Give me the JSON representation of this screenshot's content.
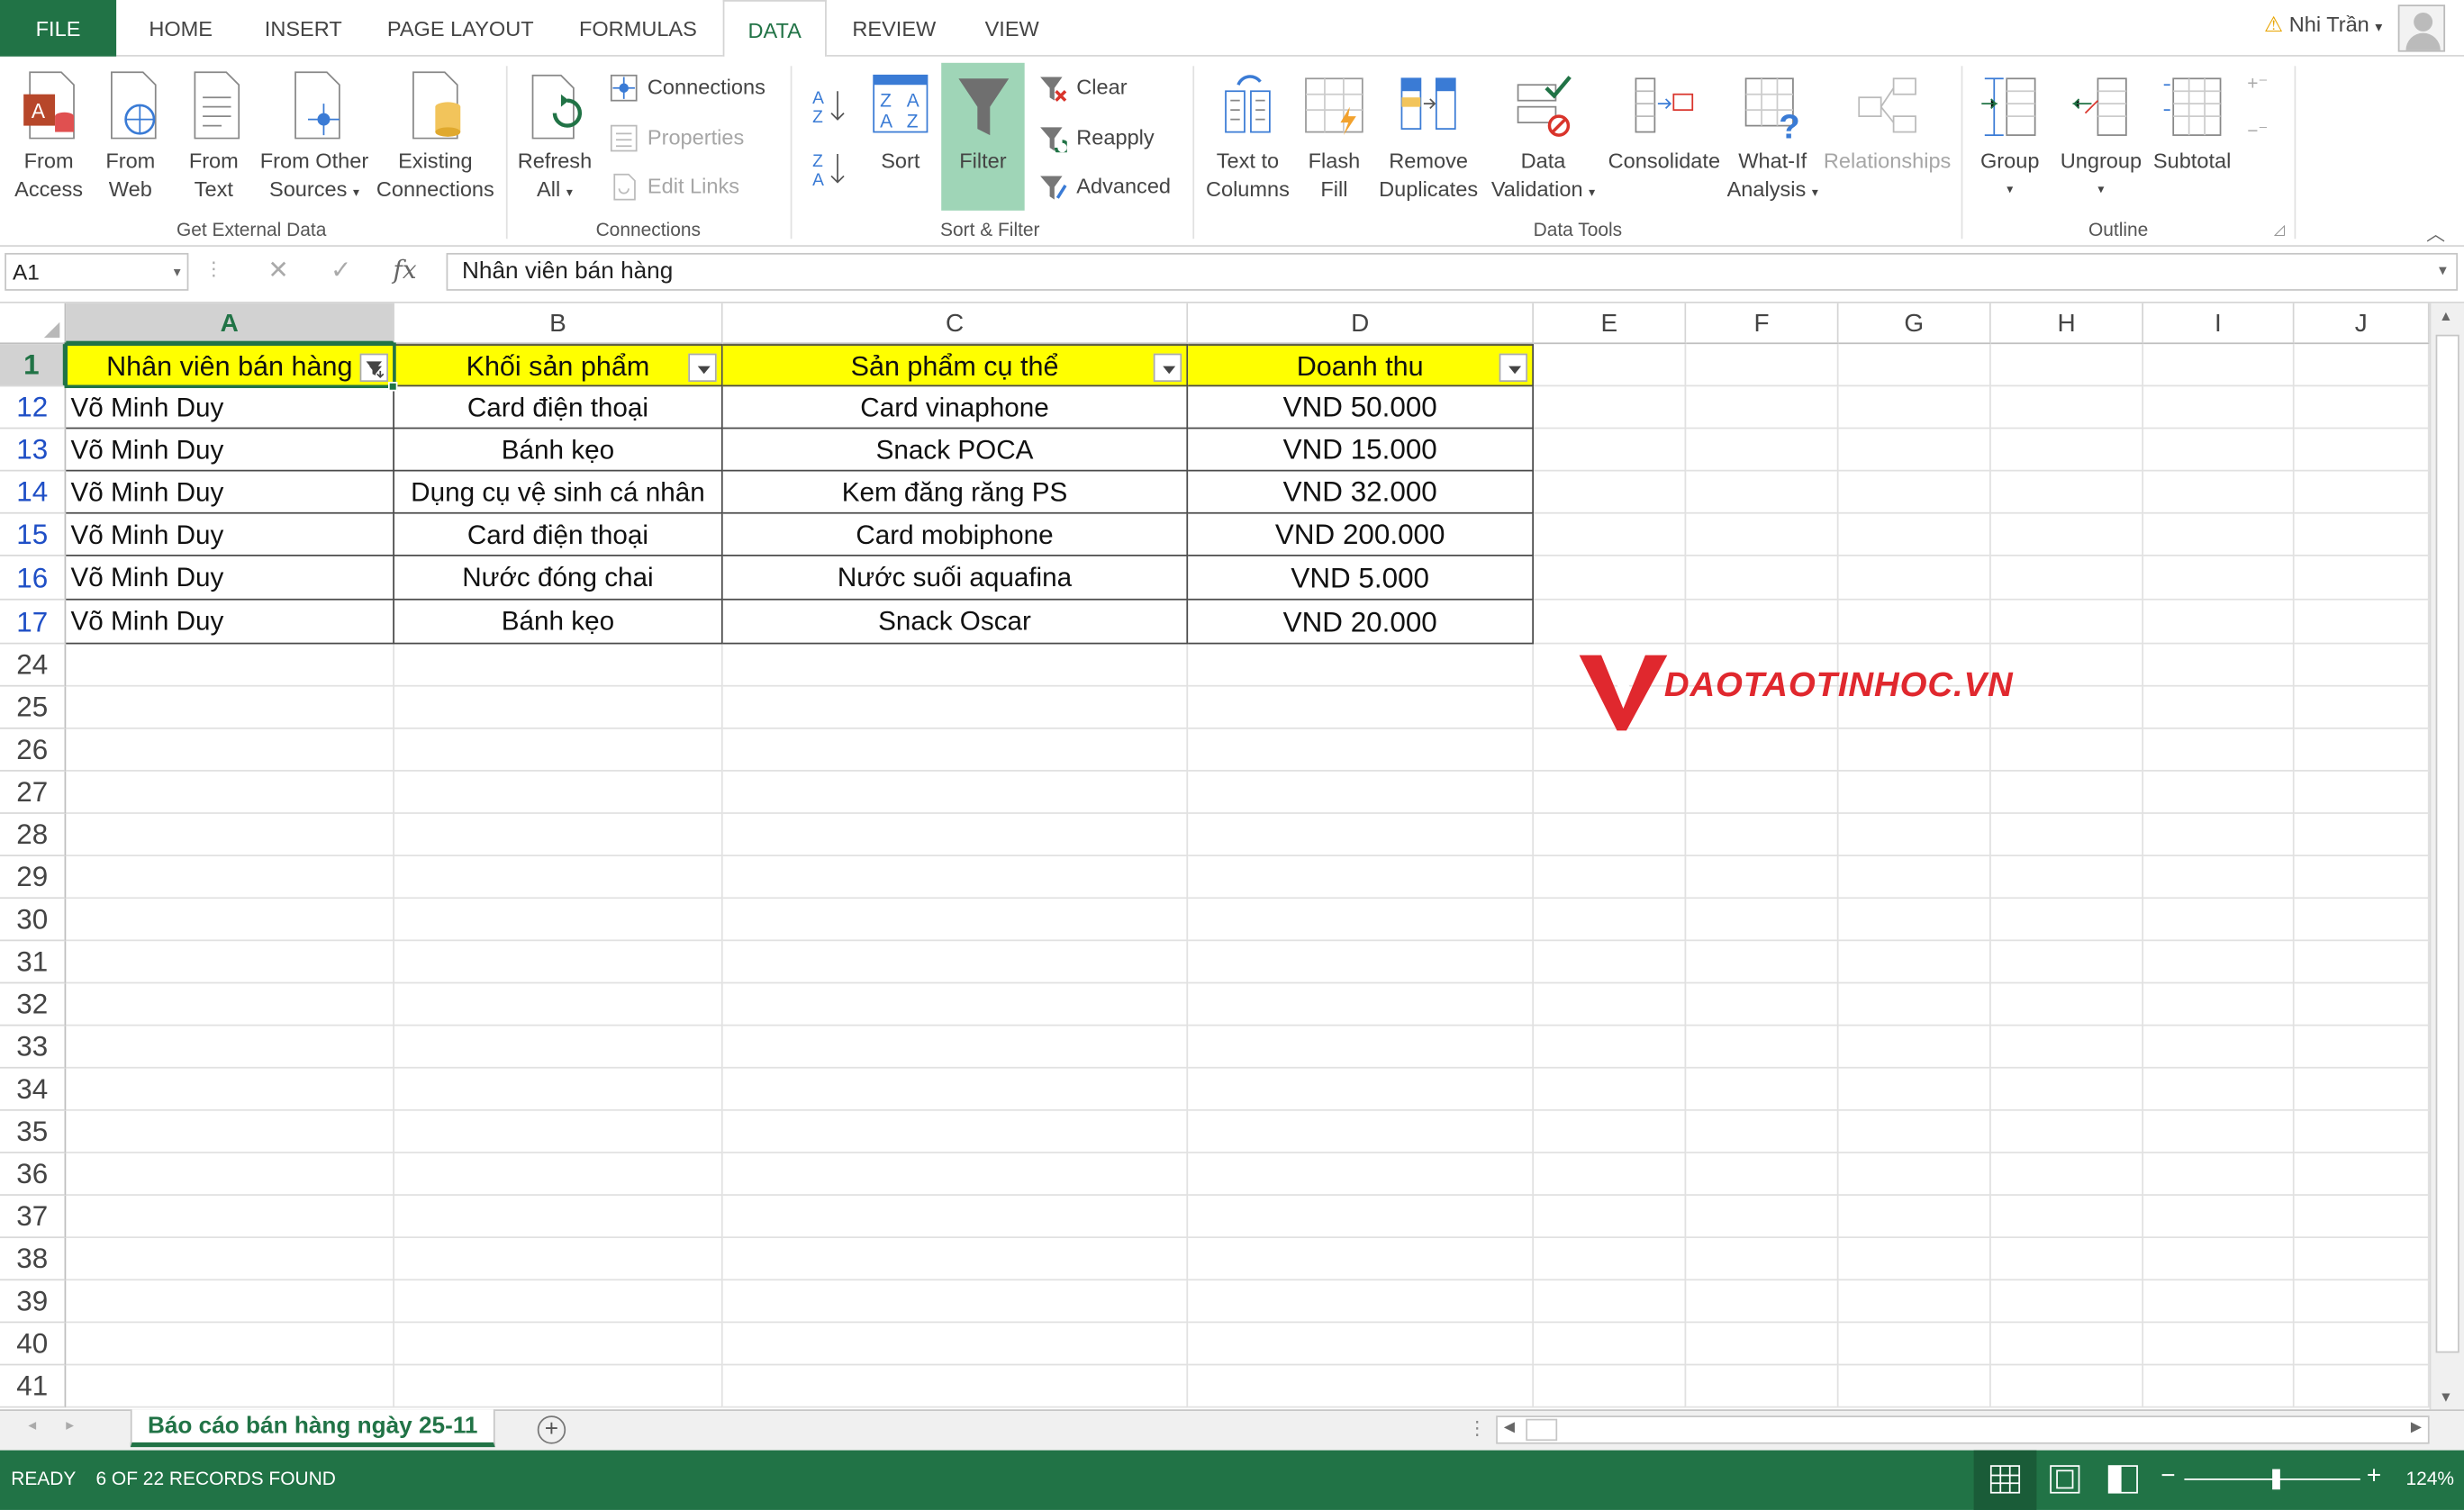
{
  "tabs": [
    "FILE",
    "HOME",
    "INSERT",
    "PAGE LAYOUT",
    "FORMULAS",
    "DATA",
    "REVIEW",
    "VIEW"
  ],
  "active_tab": "DATA",
  "user_name": "Nhi Trần",
  "ribbon": {
    "get_external_data": {
      "label": "Get External Data",
      "buttons": [
        [
          "From",
          "Access"
        ],
        [
          "From",
          "Web"
        ],
        [
          "From",
          "Text"
        ],
        [
          "From Other",
          "Sources"
        ],
        [
          "Existing",
          "Connections"
        ]
      ]
    },
    "connections": {
      "label": "Connections",
      "refresh": [
        "Refresh",
        "All"
      ],
      "items": [
        "Connections",
        "Properties",
        "Edit Links"
      ]
    },
    "sort_filter": {
      "label": "Sort & Filter",
      "sort": "Sort",
      "filter": "Filter",
      "items": [
        "Clear",
        "Reapply",
        "Advanced"
      ]
    },
    "data_tools": {
      "label": "Data Tools",
      "buttons": [
        [
          "Text to",
          "Columns"
        ],
        [
          "Flash",
          "Fill"
        ],
        [
          "Remove",
          "Duplicates"
        ],
        [
          "Data",
          "Validation"
        ],
        [
          "Consolidate",
          ""
        ],
        [
          "What-If",
          "Analysis"
        ],
        [
          "Relationships",
          ""
        ]
      ]
    },
    "outline": {
      "label": "Outline",
      "buttons": [
        "Group",
        "Ungroup",
        "Subtotal"
      ]
    }
  },
  "formula_bar": {
    "name_box": "A1",
    "fx": "fx",
    "value": "Nhân viên bán hàng"
  },
  "columns": [
    "A",
    "B",
    "C",
    "D",
    "E",
    "F",
    "G",
    "H",
    "I",
    "J"
  ],
  "headers": [
    "Nhân viên bán hàng",
    "Khối sản phẩm",
    "Sản phẩm cụ thể",
    "Doanh thu"
  ],
  "rows": [
    {
      "num": "12",
      "a": "Võ Minh Duy",
      "b": "Card điện thoại",
      "c": "Card vinaphone",
      "d": "VND 50.000"
    },
    {
      "num": "13",
      "a": "Võ Minh Duy",
      "b": "Bánh kẹo",
      "c": "Snack POCA",
      "d": "VND 15.000"
    },
    {
      "num": "14",
      "a": "Võ Minh Duy",
      "b": "Dụng cụ vệ sinh cá nhân",
      "c": "Kem đăng răng PS",
      "d": "VND 32.000"
    },
    {
      "num": "15",
      "a": "Võ Minh Duy",
      "b": "Card điện thoại",
      "c": "Card mobiphone",
      "d": "VND 200.000"
    },
    {
      "num": "16",
      "a": "Võ Minh Duy",
      "b": "Nước đóng chai",
      "c": "Nước suối aquafina",
      "d": "VND 5.000"
    },
    {
      "num": "17",
      "a": "Võ Minh Duy",
      "b": "Bánh kẹo",
      "c": "Snack Oscar",
      "d": "VND 20.000"
    }
  ],
  "empty_rows": [
    "24",
    "25",
    "26",
    "27",
    "28",
    "29",
    "30",
    "31",
    "32",
    "33",
    "34",
    "35",
    "36",
    "37",
    "38",
    "39",
    "40",
    "41"
  ],
  "header_row_num": "1",
  "watermark": "DAOTAOTINHOC.VN",
  "sheet_tab": "Báo cáo bán hàng ngày 25-11",
  "status": {
    "ready": "READY",
    "records": "6 OF 22 RECORDS FOUND",
    "zoom": "124%"
  },
  "colors": {
    "excel_green": "#217346",
    "header_fill": "#ffff00",
    "watermark_red": "#e0282e"
  }
}
